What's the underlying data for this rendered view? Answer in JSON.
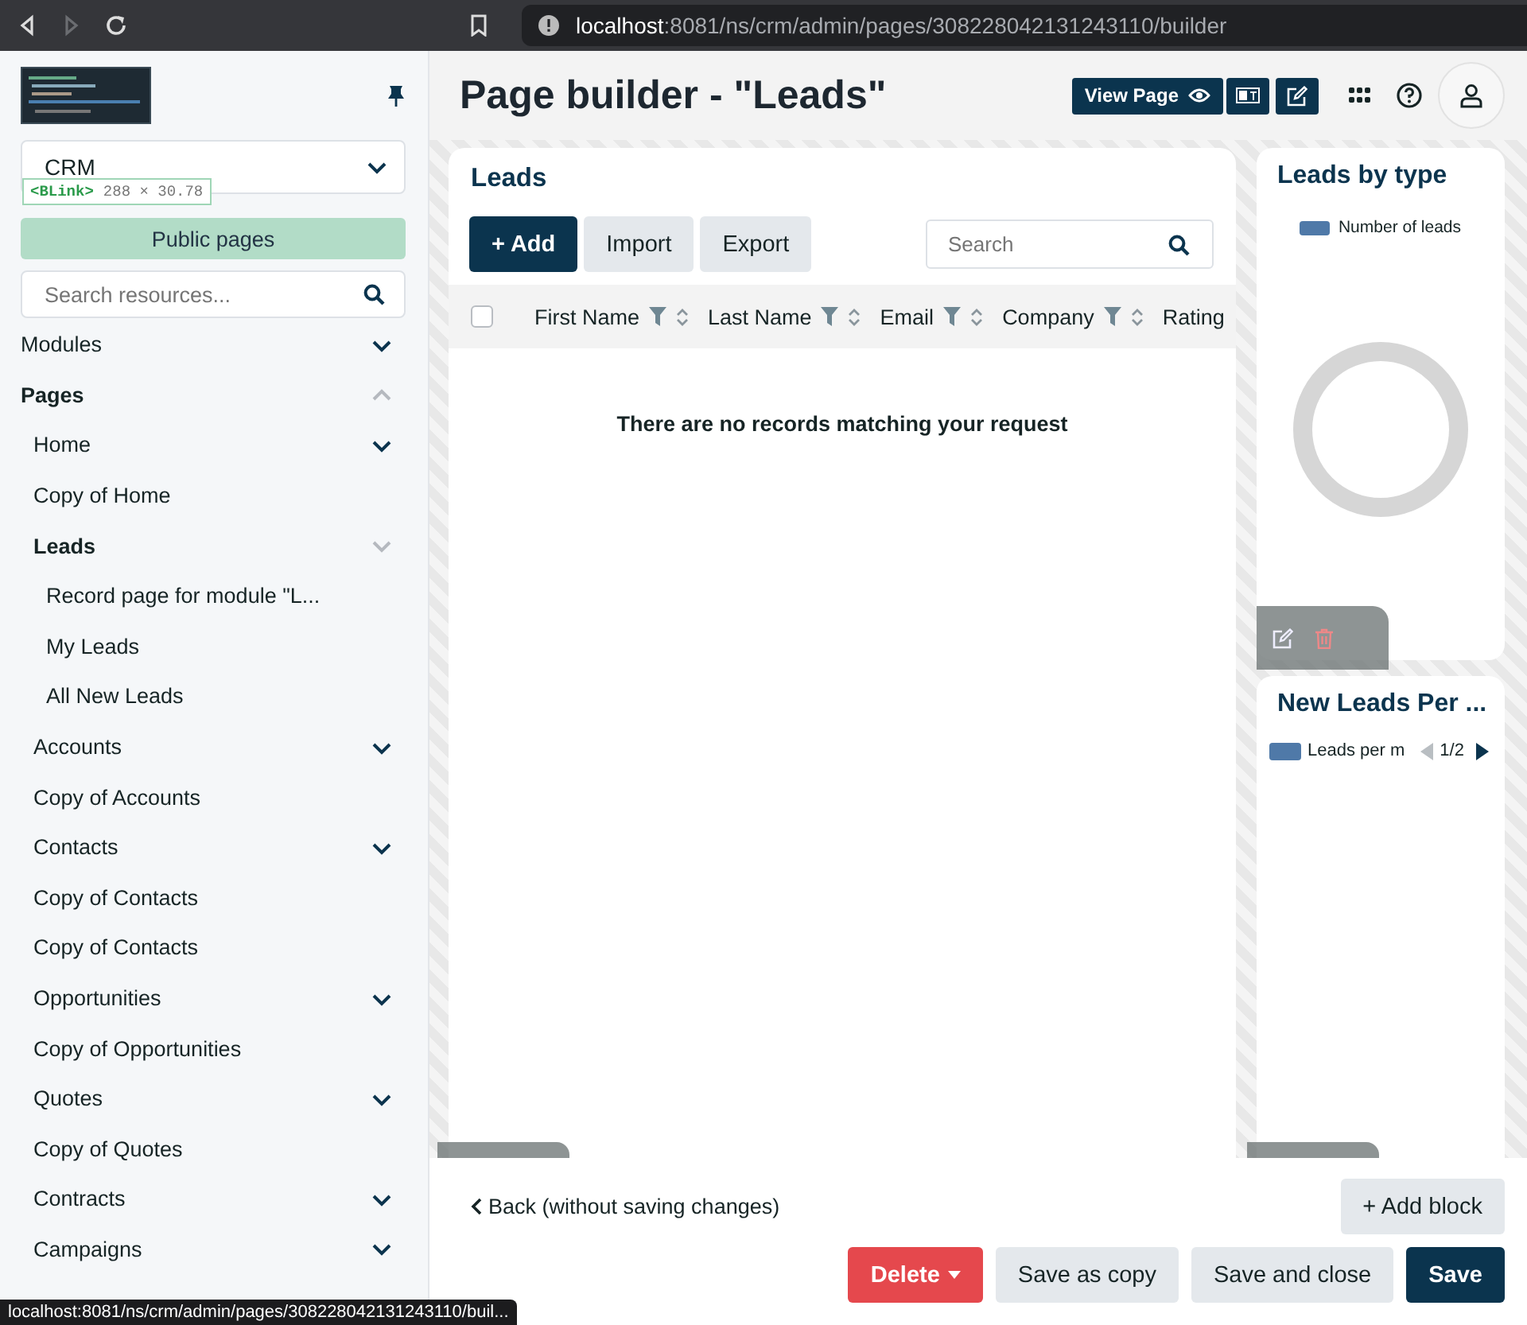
{
  "browser": {
    "url_host": "localhost",
    "url_path": ":8081/ns/crm/admin/pages/308228042131243110/builder",
    "forward_disabled": true
  },
  "sidebar": {
    "app_select": "CRM",
    "inspector_tag": "<BLink>",
    "inspector_size": "288 × 30.78",
    "public_pages_button": "Public pages",
    "search": {
      "placeholder": "Search resources..."
    },
    "items": [
      {
        "label": "Modules",
        "expanded": false
      },
      {
        "label": "Pages",
        "expanded": true,
        "children": [
          {
            "label": "Home",
            "expanded": false
          },
          {
            "label": "Copy of Home"
          },
          {
            "label": "Leads",
            "expanded": true,
            "children": [
              {
                "label": "Record page for module \"L..."
              },
              {
                "label": "My Leads"
              },
              {
                "label": "All New Leads"
              }
            ]
          },
          {
            "label": "Accounts",
            "expanded": false
          },
          {
            "label": "Copy of Accounts"
          },
          {
            "label": "Contacts",
            "expanded": false
          },
          {
            "label": "Copy of Contacts"
          },
          {
            "label": "Copy of Contacts"
          },
          {
            "label": "Opportunities",
            "expanded": false
          },
          {
            "label": "Copy of Opportunities"
          },
          {
            "label": "Quotes",
            "expanded": false
          },
          {
            "label": "Copy of Quotes"
          },
          {
            "label": "Contracts",
            "expanded": false
          },
          {
            "label": "Campaigns",
            "expanded": false
          }
        ]
      }
    ]
  },
  "header": {
    "title": "Page builder - \"Leads\"",
    "view_page_button": "View Page"
  },
  "leads_block": {
    "title": "Leads",
    "buttons": [
      {
        "label": "+ Add",
        "kind": "primary"
      },
      {
        "label": "Import",
        "kind": "secondary"
      },
      {
        "label": "Export",
        "kind": "secondary"
      }
    ],
    "search": {
      "placeholder": "Search"
    },
    "select_all_checked": false,
    "columns": [
      {
        "label": "First Name",
        "filter": true
      },
      {
        "label": "Last Name",
        "filter": true
      },
      {
        "label": "Email",
        "filter": true
      },
      {
        "label": "Company",
        "filter": true
      },
      {
        "label": "Rating",
        "filter": false
      }
    ],
    "empty_message": "There are no records matching your request"
  },
  "chart_blocks": [
    {
      "title": "Leads by type",
      "legend": "Number of leads",
      "kind": "donut"
    },
    {
      "title": "New Leads Per ...",
      "legend": "Leads per m",
      "pager": "1/2",
      "kind": "paged"
    }
  ],
  "footer": {
    "back_link": "Back (without saving changes)",
    "add_block_button": "+ Add block",
    "actions": [
      {
        "label": "Delete",
        "kind": "danger"
      },
      {
        "label": "Save as copy",
        "kind": "secondary"
      },
      {
        "label": "Save and close",
        "kind": "secondary"
      },
      {
        "label": "Save",
        "kind": "primary"
      }
    ]
  },
  "status_url": "localhost:8081/ns/crm/admin/pages/308228042131243110/buil..."
}
